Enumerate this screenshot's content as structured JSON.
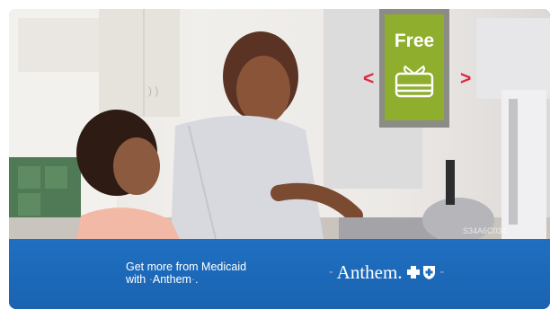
{
  "promo": {
    "badge_label": "Free",
    "prev_arrow": "<",
    "next_arrow": ">",
    "icons": [
      "gift-card-icon",
      "blue-cross-icon",
      "blue-shield-icon"
    ]
  },
  "footer": {
    "line1": "Get more from Medicaid",
    "line2_prefix": "with ",
    "line2_brand": "Anthem",
    "line2_suffix": ".",
    "brand_logo_text": "Anthem."
  },
  "colors": {
    "footer_blue": "#1f6fc1",
    "badge_green": "#8fae2e",
    "badge_frame": "#8b8c85",
    "arrow_red": "#e4223e"
  }
}
